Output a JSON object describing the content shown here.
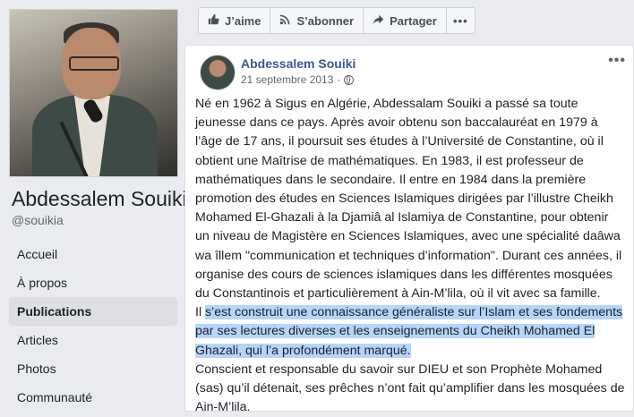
{
  "page": {
    "name": "Abdessalem Souiki",
    "handle": "@souikia"
  },
  "nav": [
    {
      "label": "Accueil",
      "active": false
    },
    {
      "label": "À propos",
      "active": false
    },
    {
      "label": "Publications",
      "active": true
    },
    {
      "label": "Articles",
      "active": false
    },
    {
      "label": "Photos",
      "active": false
    },
    {
      "label": "Communauté",
      "active": false
    }
  ],
  "actions": {
    "like": "J’aime",
    "subscribe": "S’abonner",
    "share": "Partager",
    "more": "•••"
  },
  "post": {
    "author": "Abdessalem Souiki",
    "date": "21 septembre 2013",
    "separator": "·",
    "menu": "•••",
    "paragraph1": "Né en 1962 à Sigus en Algérie, Abdessalam Souiki a passé sa toute jeunesse dans ce pays. Après avoir obtenu son baccalauréat en 1979 à l’âge de 17 ans, il poursuit ses études à l’Université de Constantine, où il obtient une Maîtrise de mathématiques. En 1983, il est professeur de mathématiques dans le secondaire. Il entre en 1984 dans la première promotion des études en Sciences Islamiques dirigées par l’illustre Cheikh Mohamed El-Ghazali à la Djamiâ al Islamiya de Constantine, pour obtenir un niveau de Magistère en Sciences Islamiques, avec une spécialité daâwa wa îllem \"communication et techniques d’information\". Durant ces années, il organise des cours de sciences islamiques dans les différentes mosquées du Constantinois et particulièrement à Ain-M’lila, où il vit avec sa famille.",
    "paragraph2_start": "Il ",
    "paragraph2_highlight": "s’est construit une connaissance généraliste sur l’Islam et ses fondements par ses lectures diverses et les enseignements du Cheikh Mohamed El Ghazali, qui l’a profondément marqué.",
    "paragraph3": "Conscient et responsable du savoir sur DIEU et son Prophète Mohamed (sas) qu’il détenait, ses prêches n’ont fait qu’amplifier dans les mosquées de Ain-M’lila."
  },
  "icons": {
    "like": "thumbs-up-icon",
    "subscribe": "rss-icon",
    "share": "share-arrow-icon",
    "privacy": "globe-icon"
  }
}
